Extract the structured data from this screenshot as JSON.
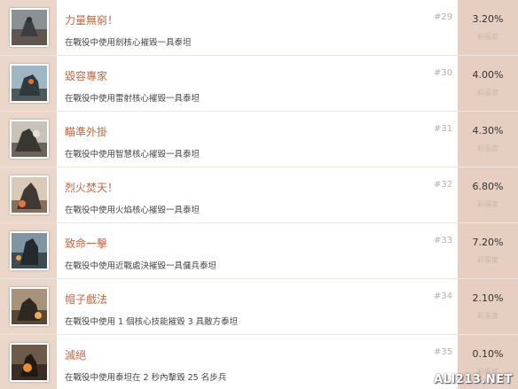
{
  "rows": [
    {
      "title": "力量無窮！",
      "desc": "在戰役中使用劍核心摧毀一具泰坦",
      "num": "#29",
      "pct": "3.20%",
      "sub": "彩蛋度"
    },
    {
      "title": "毀容專家",
      "desc": "在戰役中使用雷射核心摧毀一具泰坦",
      "num": "#30",
      "pct": "4.00%",
      "sub": "彩蛋度"
    },
    {
      "title": "瞄準外掛",
      "desc": "在戰役中使用智慧核心摧毀一具泰坦",
      "num": "#31",
      "pct": "4.30%",
      "sub": "彩蛋度"
    },
    {
      "title": "烈火焚天！",
      "desc": "在戰役中使用火焰核心摧毀一具泰坦",
      "num": "#32",
      "pct": "6.80%",
      "sub": "彩蛋度"
    },
    {
      "title": "致命一擊",
      "desc": "在戰役中使用近戰處決摧毀一具傭兵泰坦",
      "num": "#33",
      "pct": "7.20%",
      "sub": "彩蛋度"
    },
    {
      "title": "帽子戲法",
      "desc": "在戰役中使用 1 個核心技能摧毀 3 具敵方泰坦",
      "num": "#34",
      "pct": "2.10%",
      "sub": "彩蛋度"
    },
    {
      "title": "滅絕",
      "desc": "在戰役中使用泰坦在 2 秒內擊毀 25 名步兵",
      "num": "#35",
      "pct": "0.10%",
      "sub": "彩蛋度"
    }
  ],
  "watermark": "ALI213.NET",
  "colors": {
    "title": "#c8643c",
    "left_band": "#ead7c9",
    "right_band": "#e6cec0"
  }
}
